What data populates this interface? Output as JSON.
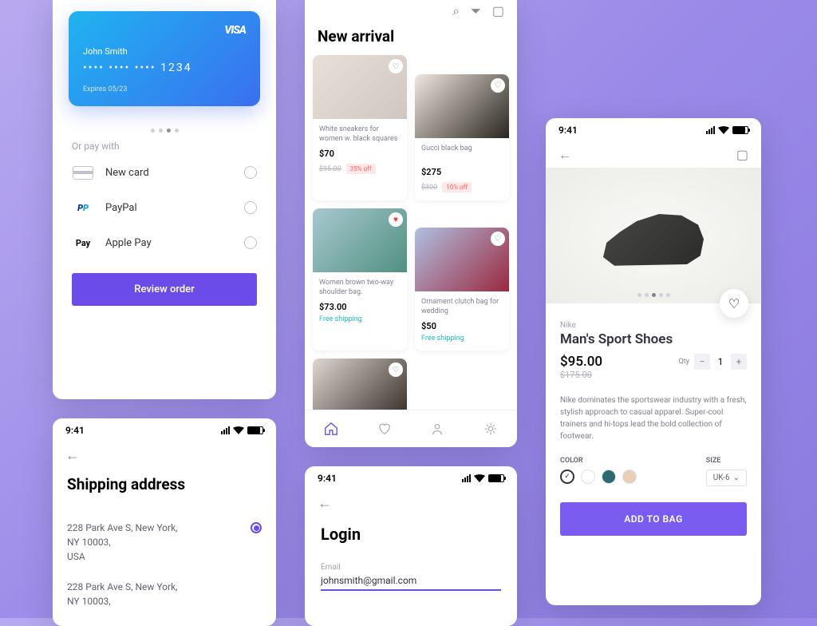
{
  "payment": {
    "card": {
      "brand": "VISA",
      "holder": "John Smith",
      "number": "•••• •••• •••• 1234",
      "expires": "Expires 05/23"
    },
    "or_pay_with": "Or pay with",
    "options": [
      {
        "label": "New card"
      },
      {
        "label": "PayPal"
      },
      {
        "label": "Apple Pay"
      }
    ],
    "review_btn": "Review order"
  },
  "shipping": {
    "time": "9:41",
    "title": "Shipping address",
    "addresses": [
      {
        "text": "228 Park Ave S, New York,\nNY 10003,\nUSA"
      },
      {
        "text": "228 Park Ave S, New York,\nNY 10003,"
      }
    ]
  },
  "arrival": {
    "title": "New arrival",
    "products": [
      {
        "name": "White sneakers for women w. black squares",
        "price": "$70",
        "old": "$95.00",
        "badge": "35% off"
      },
      {
        "name": "Gucci black bag",
        "price": "$275",
        "old": "$300",
        "badge": "10% off"
      },
      {
        "name": "Women brown two-way shoulder bag.",
        "price": "$73.00",
        "ship": "Free shipping"
      },
      {
        "name": "Ornament clutch bag for wedding",
        "price": "$50",
        "ship": "Free shipping"
      }
    ]
  },
  "login": {
    "time": "9:41",
    "title": "Login",
    "email_label": "Email",
    "email_value": "johnsmith@gmail.com"
  },
  "detail": {
    "time": "9:41",
    "brand": "Nike",
    "title": "Man's Sport Shoes",
    "price": "$95.00",
    "old": "$175.00",
    "qty_label": "Qty",
    "qty": "1",
    "desc": "Nike dominates the sportswear industry with a fresh, stylish approach to casual apparel. Super-cool trainers and hi-tops lead the bold collection of footwear.",
    "color_label": "COLOR",
    "size_label": "SIZE",
    "size_value": "UK-6",
    "colors": [
      "#303040",
      "#ffffff",
      "#2a6a70",
      "#e8d0b8"
    ],
    "add_btn": "ADD TO BAG"
  }
}
